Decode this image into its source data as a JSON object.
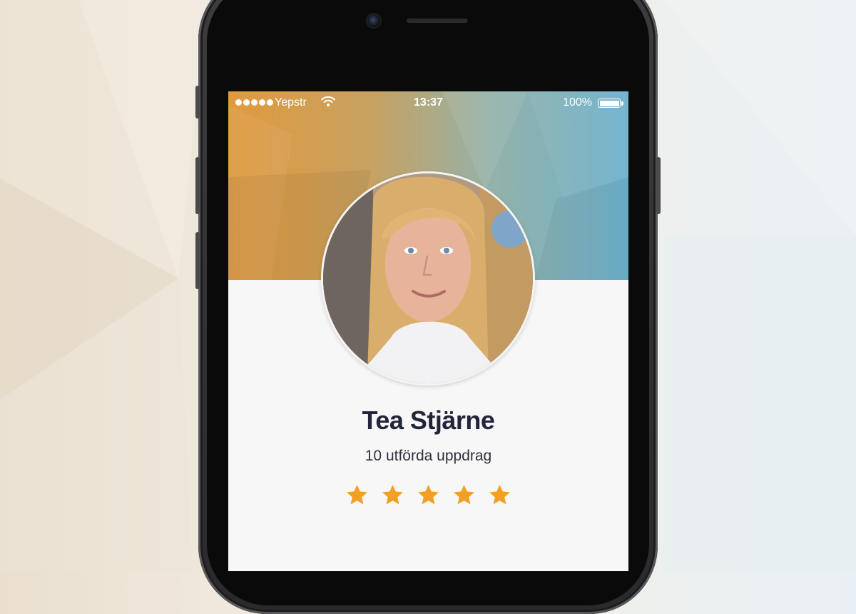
{
  "status_bar": {
    "carrier": "Yepstr",
    "time": "13:37",
    "battery_percent": "100%",
    "signal_bars": 5,
    "battery_level": 1.0
  },
  "profile": {
    "name": "Tea Stjärne",
    "completed_tasks": "10 utförda uppdrag",
    "rating": 5,
    "rating_max": 5
  },
  "colors": {
    "header_gradient_start": "#e09a3e",
    "header_gradient_end": "#6db1cd",
    "star": "#f2a024",
    "name_text": "#22243a",
    "screen_background": "#f7f7f7"
  },
  "icons": [
    "wifi-icon",
    "battery-icon",
    "star-icon",
    "camera-icon"
  ]
}
